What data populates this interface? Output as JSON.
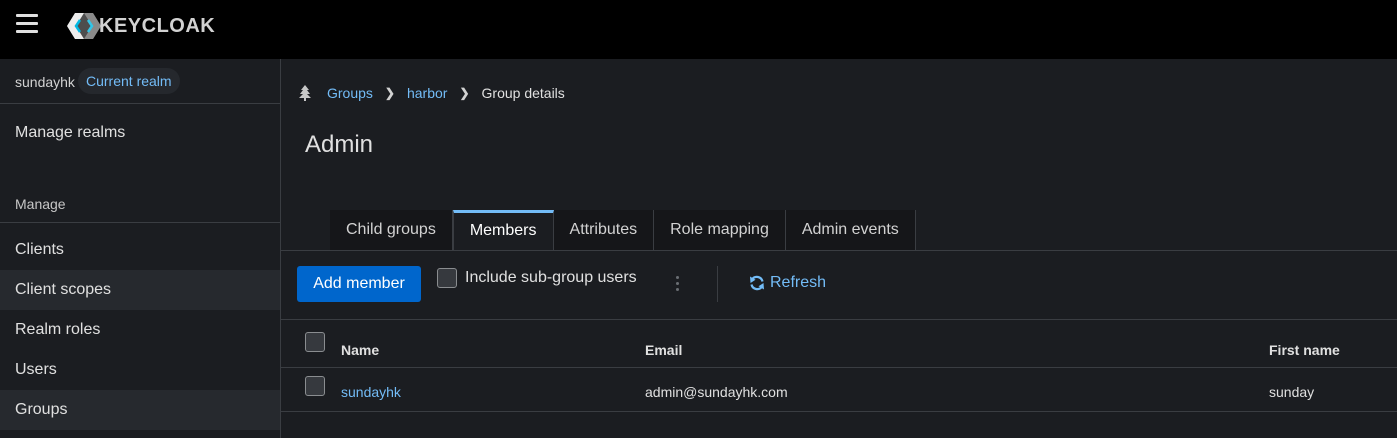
{
  "header": {
    "logo_text": "KEYCLOAK",
    "menu_icon": "hamburger-icon",
    "logo_icon": "keycloak-logo-icon"
  },
  "sidebar": {
    "realm_name": "sundayhk",
    "realm_badge": "Current realm",
    "manage_realms": "Manage realms",
    "section_label": "Manage",
    "items": [
      {
        "label": "Clients",
        "active": false
      },
      {
        "label": "Client scopes",
        "active": true
      },
      {
        "label": "Realm roles",
        "active": false
      },
      {
        "label": "Users",
        "active": false
      },
      {
        "label": "Groups",
        "active": true
      }
    ]
  },
  "breadcrumb": {
    "icon": "tree-icon",
    "items": [
      "Groups",
      "harbor"
    ],
    "current": "Group details"
  },
  "page_title": "Admin",
  "tabs": [
    {
      "label": "Child groups",
      "active": false
    },
    {
      "label": "Members",
      "active": true
    },
    {
      "label": "Attributes",
      "active": false
    },
    {
      "label": "Role mapping",
      "active": false
    },
    {
      "label": "Admin events",
      "active": false
    }
  ],
  "toolbar": {
    "add_member_label": "Add member",
    "include_subgroup_label": "Include sub-group users",
    "refresh_label": "Refresh",
    "refresh_icon": "sync-icon",
    "kebab_icon": "kebab-icon"
  },
  "table": {
    "columns": [
      "Name",
      "Email",
      "First name"
    ],
    "rows": [
      {
        "name": "sundayhk",
        "email": "admin@sundayhk.com",
        "first_name": "sunday"
      }
    ]
  },
  "colors": {
    "primary": "#0066cc",
    "link": "#73bcf7",
    "background": "#1b1d21",
    "topbar": "#000000"
  }
}
